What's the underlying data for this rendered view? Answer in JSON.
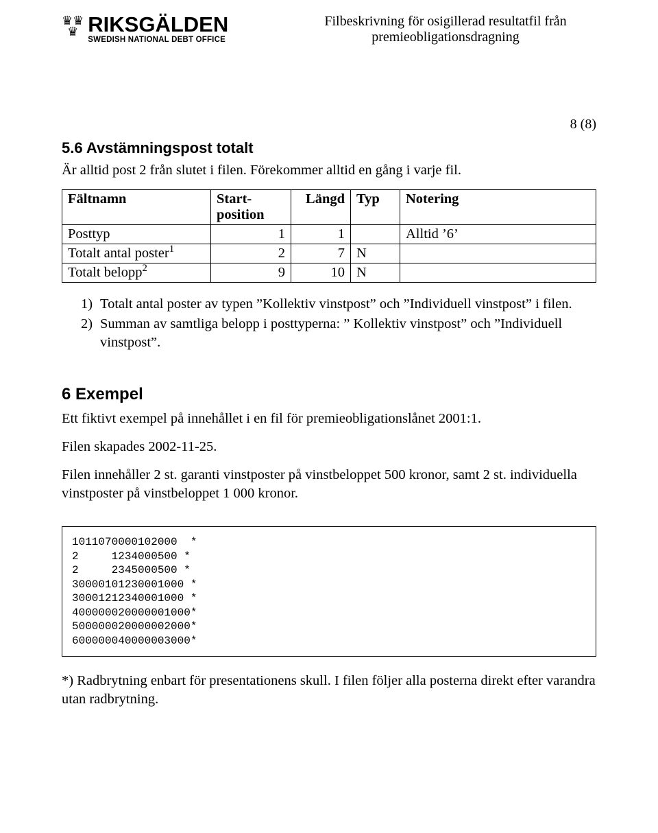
{
  "header": {
    "logo_name": "RIKSGÄLDEN",
    "logo_sub": "SWEDISH NATIONAL DEBT OFFICE",
    "title_line1": "Filbeskrivning för osigillerad resultatfil från",
    "title_line2": "premieobligationsdragning",
    "page_number": "8 (8)"
  },
  "section_56": {
    "heading": "5.6   Avstämningspost totalt",
    "intro": "Är alltid post 2 från slutet i filen. Förekommer alltid en gång i varje fil."
  },
  "table": {
    "headers": {
      "faltnamn": "Fältnamn",
      "startpos": "Start-\nposition",
      "langd": "Längd",
      "typ": "Typ",
      "notering": "Notering"
    },
    "rows": [
      {
        "faltnamn": "Posttyp",
        "startpos": "1",
        "langd": "1",
        "typ": "",
        "notering": "Alltid ’6’",
        "sup": ""
      },
      {
        "faltnamn": "Totalt antal poster",
        "startpos": "2",
        "langd": "7",
        "typ": "N",
        "notering": "",
        "sup": "1"
      },
      {
        "faltnamn": "Totalt belopp",
        "startpos": "9",
        "langd": "10",
        "typ": "N",
        "notering": "",
        "sup": "2"
      }
    ]
  },
  "notes": {
    "n1": "Totalt antal poster av typen ”Kollektiv vinstpost” och ”Individuell vinstpost” i filen.",
    "n2": "Summan av samtliga belopp i posttyperna: ” Kollektiv vinstpost” och ”Individuell vinstpost”.",
    "marker1": "1)",
    "marker2": "2)"
  },
  "section_6": {
    "heading": "6    Exempel",
    "p1": "Ett fiktivt exempel på innehållet i en fil för premieobligationslånet 2001:1.",
    "p2": "Filen skapades 2002-11-25.",
    "p3": "Filen innehåller 2 st. garanti vinstposter på vinstbeloppet 500 kronor, samt 2 st. individuella vinstposter på vinstbeloppet 1 000 kronor."
  },
  "example_block": "1011070000102000  *\n2     1234000500 *\n2     2345000500 *\n30000101230001000 *\n30001212340001000 *\n400000020000001000*\n500000020000002000*\n600000040000003000*",
  "footnote": "*) Radbrytning enbart för presentationens skull. I filen följer alla posterna direkt efter varandra utan radbrytning."
}
